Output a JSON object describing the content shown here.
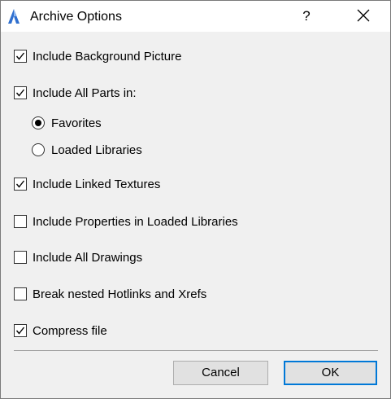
{
  "window": {
    "title": "Archive Options",
    "help_label": "?",
    "icon": "archicad-app-icon",
    "close_icon": "close-icon"
  },
  "options": [
    {
      "label": "Include Background Picture",
      "checked": true
    },
    {
      "label": "Include All Parts in:",
      "checked": true
    },
    {
      "label": "Include Linked Textures",
      "checked": true
    },
    {
      "label": "Include Properties in Loaded Libraries",
      "checked": false
    },
    {
      "label": "Include All Drawings",
      "checked": false
    },
    {
      "label": "Break nested Hotlinks and Xrefs",
      "checked": false
    },
    {
      "label": "Compress file",
      "checked": true
    }
  ],
  "parts_source": {
    "options": [
      "Favorites",
      "Loaded Libraries"
    ],
    "selected": "Favorites"
  },
  "buttons": {
    "cancel": "Cancel",
    "ok": "OK"
  },
  "colors": {
    "accent": "#0078d7",
    "dialog_bg": "#f0f0f0",
    "titlebar_bg": "#ffffff"
  }
}
